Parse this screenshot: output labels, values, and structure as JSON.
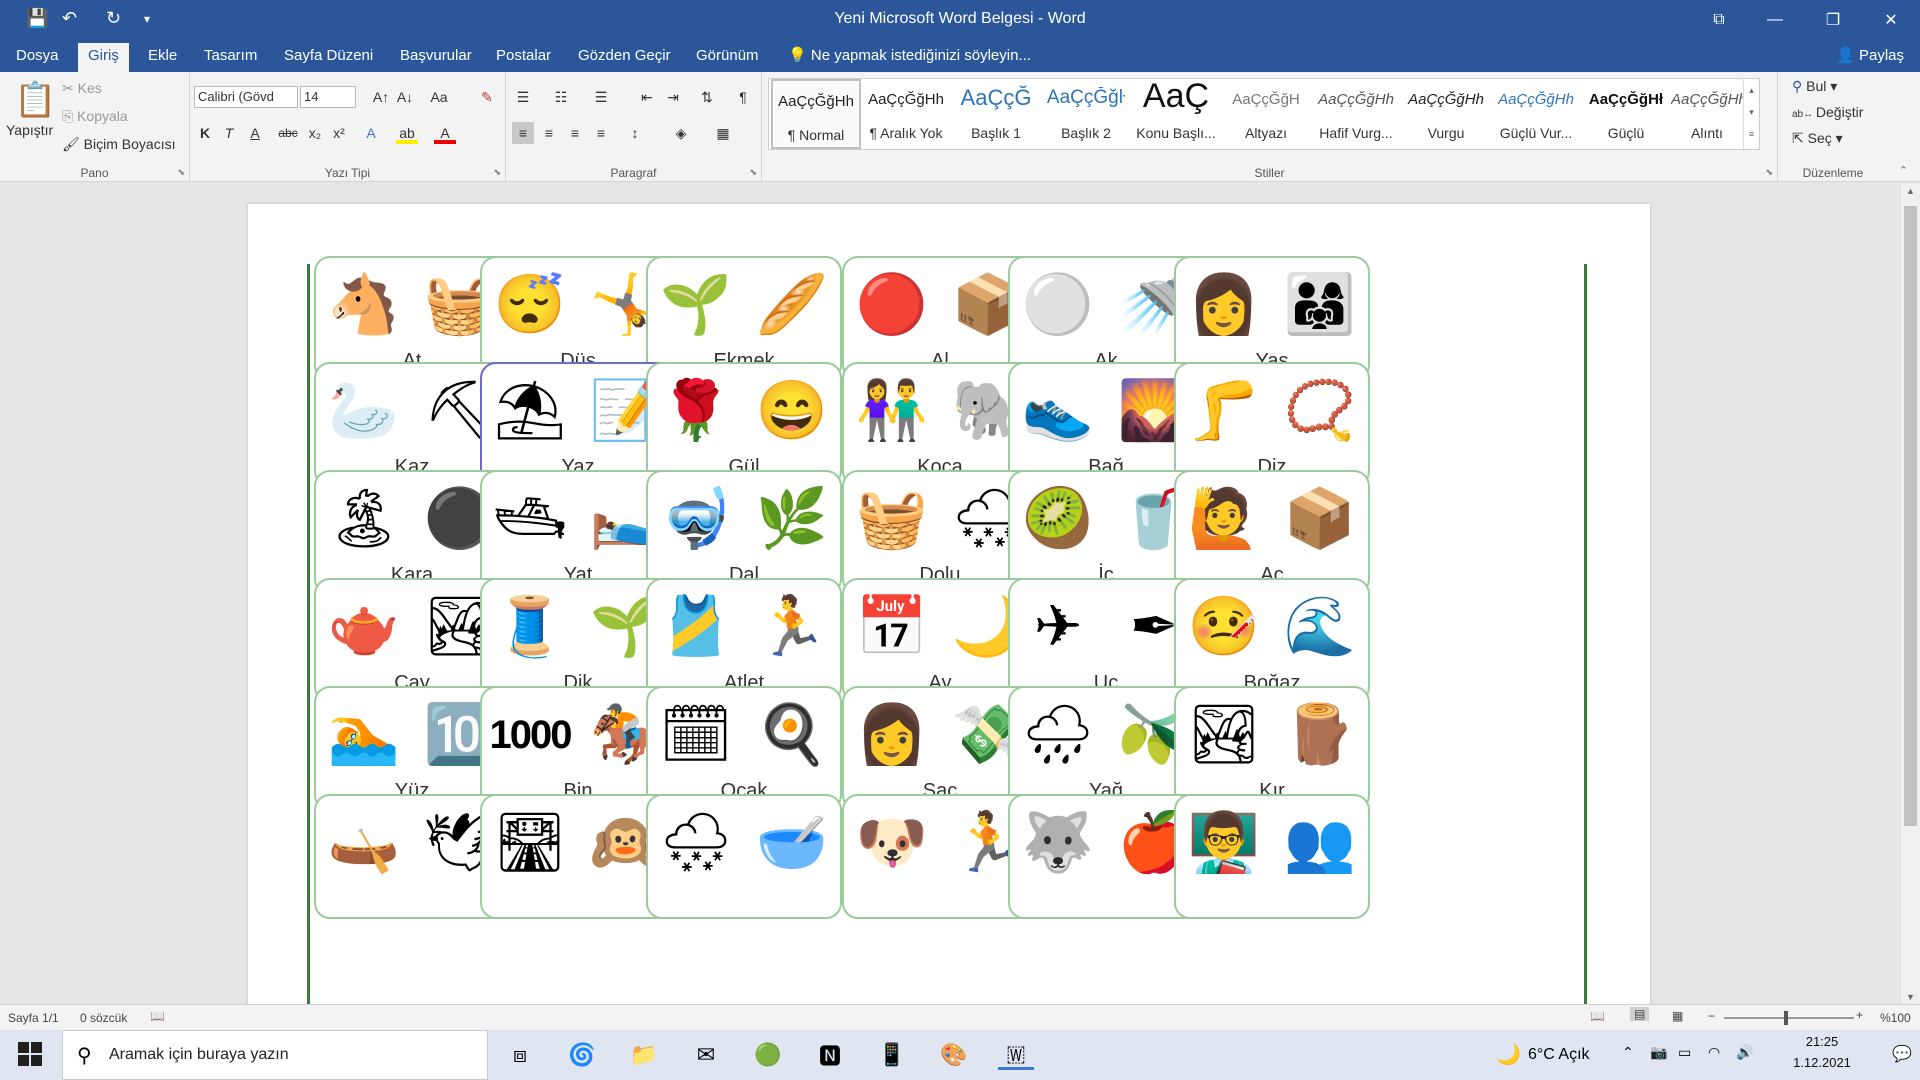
{
  "window": {
    "title": "Yeni Microsoft Word Belgesi - Word"
  },
  "quick_access": {
    "save_icon": "💾",
    "undo_icon": "↶",
    "redo_icon": "↻",
    "customize_icon": "▾"
  },
  "window_controls": {
    "restore_ribbon": "⧉",
    "minimize": "—",
    "maximize": "❐",
    "close": "✕"
  },
  "tabs": [
    "Dosya",
    "Giriş",
    "Ekle",
    "Tasarım",
    "Sayfa Düzeni",
    "Başvurular",
    "Postalar",
    "Gözden Geçir",
    "Görünüm"
  ],
  "tell_me": "Ne yapmak istediğinizi söyleyin...",
  "share": "Paylaş",
  "clipboard": {
    "paste": "Yapıştır",
    "cut": "Kes",
    "copy": "Kopyala",
    "format_painter": "Biçim Boyacısı",
    "group": "Pano"
  },
  "font": {
    "name": "Calibri (Gövd",
    "size": "14",
    "group": "Yazı Tipi",
    "grow": "A↑",
    "shrink": "A↓",
    "case": "Aa",
    "clear": "✎",
    "bold": "K",
    "italic": "T",
    "underline": "A",
    "strike": "abc",
    "sub": "x₂",
    "sup": "x²",
    "effects": "A",
    "highlight": "ab",
    "color": "A"
  },
  "paragraph": {
    "group": "Paragraf"
  },
  "styles": {
    "group": "Stiller",
    "items": [
      {
        "preview": "AaÇçĞğHh",
        "name": "¶ Normal"
      },
      {
        "preview": "AaÇçĞğHh",
        "name": "¶ Aralık Yok"
      },
      {
        "preview": "AaÇçĞ",
        "name": "Başlık 1"
      },
      {
        "preview": "AaÇçĞğŀ",
        "name": "Başlık 2"
      },
      {
        "preview": "AaÇ",
        "name": "Konu Başlı..."
      },
      {
        "preview": "AaÇçĞğH",
        "name": "Altyazı"
      },
      {
        "preview": "AaÇçĞğHh",
        "name": "Hafif Vurg..."
      },
      {
        "preview": "AaÇçĞğHh",
        "name": "Vurgu"
      },
      {
        "preview": "AaÇçĞğHh",
        "name": "Güçlü Vur..."
      },
      {
        "preview": "AaÇçĞğHł",
        "name": "Güçlü"
      },
      {
        "preview": "AaÇçĞğHh",
        "name": "Alıntı"
      }
    ]
  },
  "editing": {
    "find": "Bul",
    "replace": "Değiştir",
    "select": "Seç",
    "group": "Düzenleme"
  },
  "cards": [
    {
      "label": "At",
      "icons": [
        "🐴",
        "🧺"
      ]
    },
    {
      "label": "Düş",
      "icons": [
        "😴",
        "🤸"
      ]
    },
    {
      "label": "Ekmek",
      "icons": [
        "🌱",
        "🥖"
      ]
    },
    {
      "label": "Al",
      "icons": [
        "🔴",
        "📦"
      ]
    },
    {
      "label": "Ak",
      "icons": [
        "⚪",
        "🚿"
      ]
    },
    {
      "label": "Yaş",
      "icons": [
        "👩",
        "👨‍👩‍👧"
      ]
    },
    {
      "label": "Kaz",
      "icons": [
        "🦢",
        "⛏"
      ]
    },
    {
      "label": "Yaz",
      "icons": [
        "⛱",
        "📝"
      ]
    },
    {
      "label": "Gül",
      "icons": [
        "🌹",
        "😄"
      ]
    },
    {
      "label": "Koca",
      "icons": [
        "👫",
        "🐘"
      ]
    },
    {
      "label": "Bağ",
      "icons": [
        "👟",
        "🌄"
      ]
    },
    {
      "label": "Diz",
      "icons": [
        "🦵",
        "📿"
      ]
    },
    {
      "label": "Kara",
      "icons": [
        "🏝",
        "⚫"
      ]
    },
    {
      "label": "Yat",
      "icons": [
        "🛥",
        "🛌"
      ]
    },
    {
      "label": "Dal",
      "icons": [
        "🤿",
        "🌿"
      ]
    },
    {
      "label": "Dolu",
      "icons": [
        "🧺",
        "🌨"
      ]
    },
    {
      "label": "İç",
      "icons": [
        "🥝",
        "🥤"
      ]
    },
    {
      "label": "Aç",
      "icons": [
        "🙋",
        "📦"
      ]
    },
    {
      "label": "Çay",
      "icons": [
        "🫖",
        "🏞"
      ]
    },
    {
      "label": "Dik",
      "icons": [
        "🧵",
        "🌱"
      ]
    },
    {
      "label": "Atlet",
      "icons": [
        "🎽",
        "🏃"
      ]
    },
    {
      "label": "Ay",
      "icons": [
        "📅",
        "🌙"
      ]
    },
    {
      "label": "Uç",
      "icons": [
        "✈",
        "✒"
      ]
    },
    {
      "label": "Boğaz",
      "icons": [
        "🤒",
        "🌊"
      ]
    },
    {
      "label": "Yüz",
      "icons": [
        "🏊",
        "🔟"
      ]
    },
    {
      "label": "Bin",
      "icons": [
        "1000",
        "🏇"
      ]
    },
    {
      "label": "Ocak",
      "icons": [
        "🗓",
        "🍳"
      ]
    },
    {
      "label": "Saç",
      "icons": [
        "👩",
        "💸"
      ]
    },
    {
      "label": "Yağ",
      "icons": [
        "🌧",
        "🫒"
      ]
    },
    {
      "label": "Kır",
      "icons": [
        "🏞",
        "🪵"
      ]
    },
    {
      "label": "",
      "icons": [
        "🛶",
        "🕊"
      ]
    },
    {
      "label": "",
      "icons": [
        "🛣",
        "🙉"
      ]
    },
    {
      "label": "",
      "icons": [
        "🌨",
        "🥣"
      ]
    },
    {
      "label": "",
      "icons": [
        "🐶",
        "🏃"
      ]
    },
    {
      "label": "",
      "icons": [
        "🐺",
        "🍎"
      ]
    },
    {
      "label": "",
      "icons": [
        "👨‍🏫",
        "👥"
      ]
    }
  ],
  "status": {
    "page": "Sayfa 1/1",
    "words": "0 sözcük",
    "zoom": "%100"
  },
  "taskbar": {
    "search": "Aramak için buraya yazın",
    "weather": "6°C  Açık",
    "time": "21:25",
    "date": "1.12.2021"
  }
}
